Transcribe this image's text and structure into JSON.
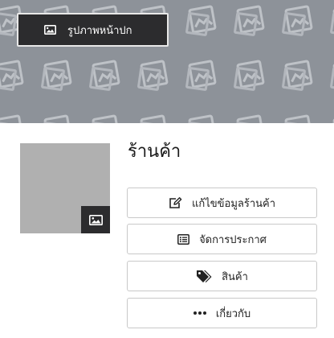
{
  "cover": {
    "button_label": "รูปภาพหน้าปก",
    "background_color": "#8d9299",
    "button_icon": "image-icon"
  },
  "profile": {
    "store_name": "ร้านค้า",
    "avatar_placeholder_color": "#b0b0b0",
    "avatar_edit_icon": "image-icon"
  },
  "actions": [
    {
      "label": "แก้ไขข้อมูลร้านค้า",
      "icon": "edit-icon"
    },
    {
      "label": "จัดการประกาศ",
      "icon": "list-icon"
    },
    {
      "label": "สินค้า",
      "icon": "tags-icon"
    },
    {
      "label": "เกี่ยวกับ",
      "icon": "ellipsis-icon"
    }
  ]
}
